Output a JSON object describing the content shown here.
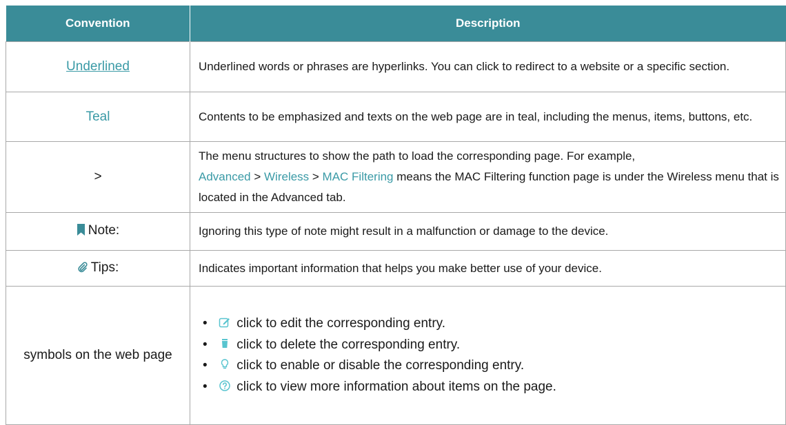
{
  "header": {
    "convention": "Convention",
    "description": "Description"
  },
  "rows": {
    "underlined": {
      "convention": "Underlined",
      "description": "Underlined words or phrases are hyperlinks. You can click to redirect to a website or a specific section."
    },
    "teal": {
      "convention": "Teal",
      "description": "Contents to be emphasized and texts on the web page are in teal, including the menus, items, buttons, etc."
    },
    "gt": {
      "convention": ">",
      "description_prefix": "The menu structures to show the path to load the corresponding page. For example,",
      "path": [
        "Advanced",
        "Wireless",
        "MAC Filtering"
      ],
      "separator": " > ",
      "description_suffix": "means the MAC Filtering function page is under the Wireless menu that is located in the Advanced tab."
    },
    "note": {
      "icon": "bookmark-icon",
      "convention": "Note:",
      "description": "Ignoring this type of note might result in a malfunction or damage to the device."
    },
    "tips": {
      "icon": "paperclip-icon",
      "convention": "Tips:",
      "description": "Indicates important information that helps you make better use of your device."
    },
    "symbols": {
      "convention": "symbols on the web page",
      "items": [
        {
          "icon": "edit-icon",
          "text": "click to edit the corresponding entry."
        },
        {
          "icon": "trash-icon",
          "text": "click to delete the corresponding entry."
        },
        {
          "icon": "lightbulb-icon",
          "text": "click to enable or disable the corresponding entry."
        },
        {
          "icon": "question-circle-icon",
          "text": "click to view more information about items on the page."
        }
      ]
    }
  },
  "colors": {
    "header_bg": "#3a8c98",
    "teal_text": "#3a9aa6",
    "border": "#a8a8a8"
  }
}
